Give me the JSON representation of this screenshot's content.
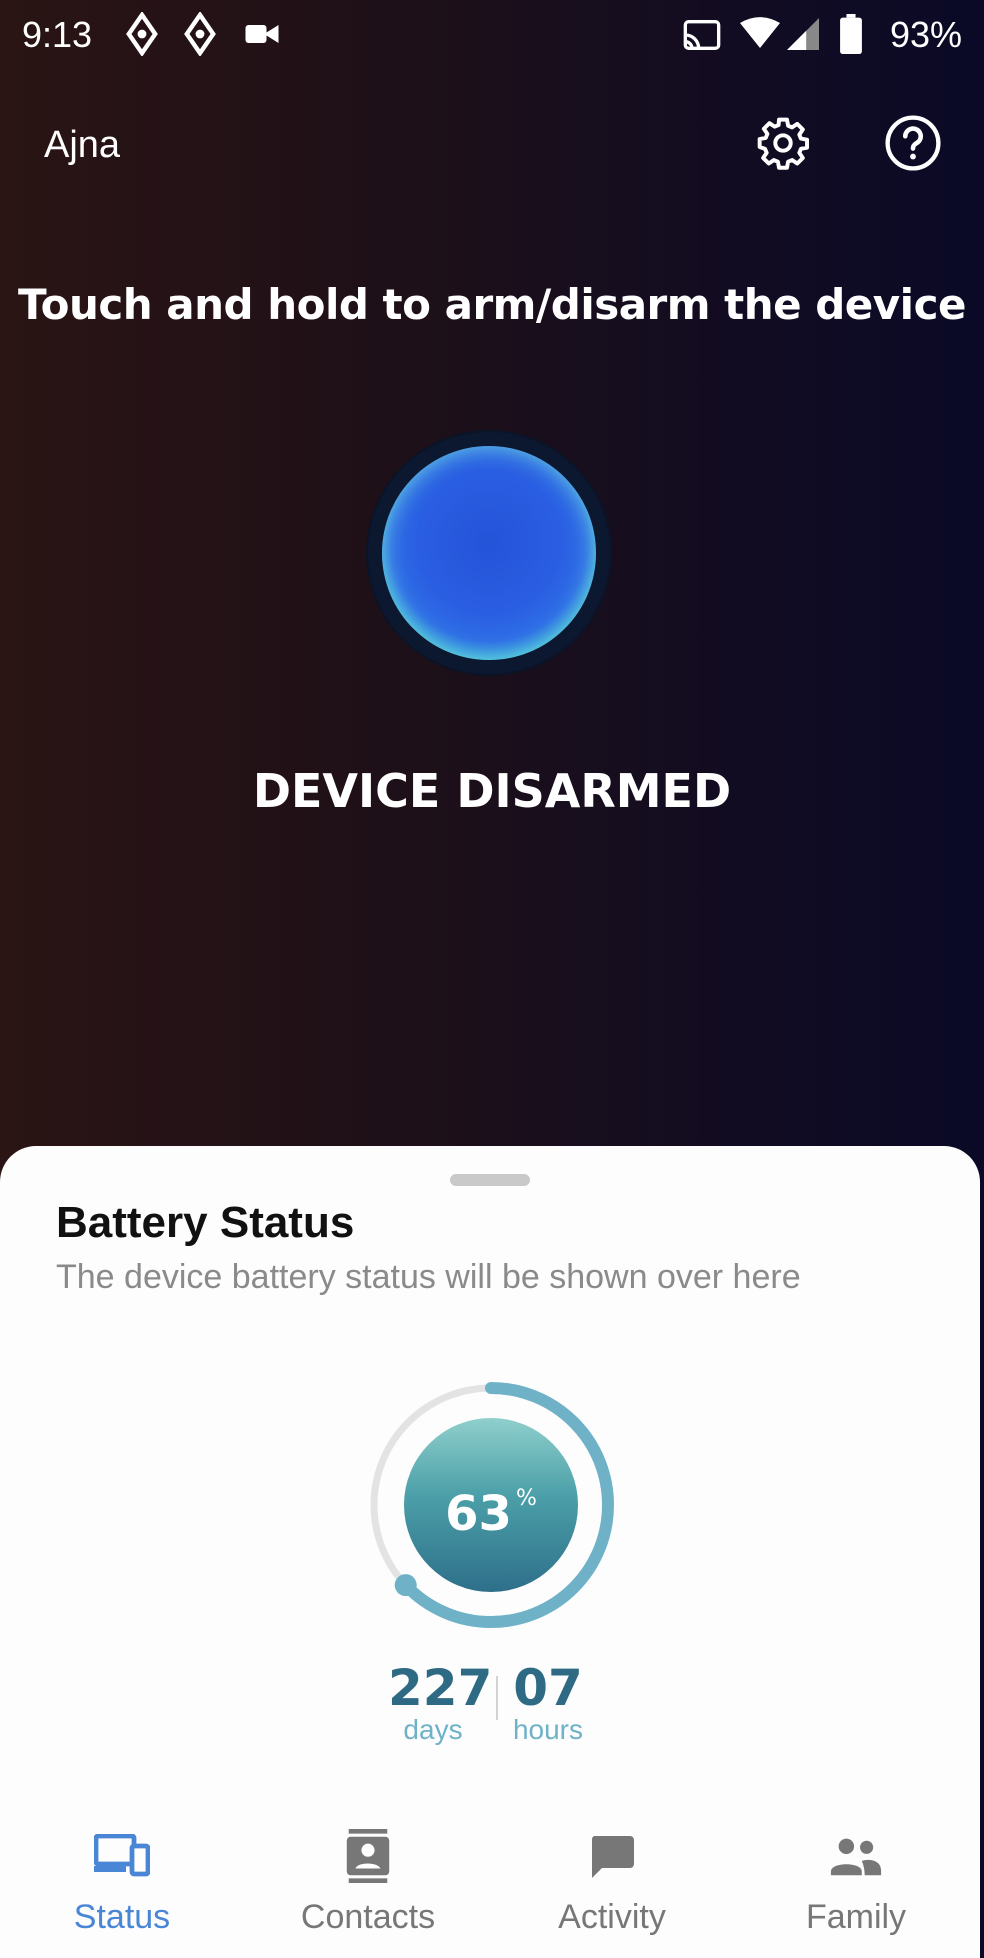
{
  "status_bar": {
    "time": "9:13",
    "battery_percent": "93%",
    "left_icons": [
      "navigation-icon",
      "navigation-icon",
      "videocam-icon"
    ],
    "right_icons": [
      "cast-icon",
      "wifi-icon",
      "signal-icon",
      "battery-icon"
    ]
  },
  "header": {
    "title": "Ajna",
    "settings_icon": "gear-icon",
    "help_icon": "help-icon"
  },
  "main": {
    "instruction": "Touch and hold to arm/disarm the device",
    "device_state": "DEVICE DISARMED"
  },
  "battery_sheet": {
    "title": "Battery Status",
    "subtitle": "The device battery status will be shown over here",
    "percent_value": "63",
    "percent_symbol": "%",
    "level_fraction": 0.63,
    "days_value": "227",
    "days_unit": "days",
    "hours_value": "07",
    "hours_unit": "hours",
    "accent": "#6fb2c8"
  },
  "nav": {
    "items": [
      {
        "label": "Status",
        "icon": "devices-icon",
        "active": true
      },
      {
        "label": "Contacts",
        "icon": "contacts-icon",
        "active": false
      },
      {
        "label": "Activity",
        "icon": "chat-icon",
        "active": false
      },
      {
        "label": "Family",
        "icon": "people-icon",
        "active": false
      }
    ],
    "active_color": "#4a86d6",
    "inactive_color": "#777777"
  }
}
